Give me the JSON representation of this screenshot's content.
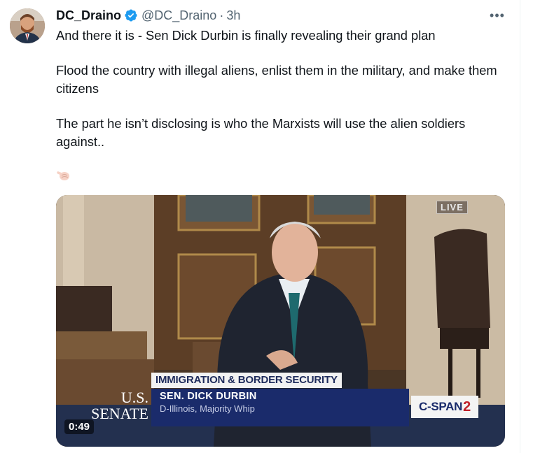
{
  "tweet": {
    "author_name": "DC_Draino",
    "handle": "@DC_Draino",
    "separator": "·",
    "time": "3h",
    "more_label": "•••",
    "paragraphs": [
      "And there it is - Sen Dick Durbin is finally revealing their grand plan",
      "Flood the country with illegal aliens, enlist them in the military, and make them citizens",
      "The part he isn’t disclosing is who the Marxists will use the alien soldiers against.."
    ],
    "emoji_icon": "pointing-hand-icon"
  },
  "video": {
    "live_badge": "LIVE",
    "chyron_topic": "IMMIGRATION & BORDER SECURITY",
    "chyron_name": "SEN. DICK DURBIN",
    "chyron_title": "D-Illinois, Majority Whip",
    "senate_line1": "U.S.",
    "senate_line2": "SENATE",
    "network_text": "C-SPAN",
    "network_number": "2",
    "duration": "0:49"
  },
  "colors": {
    "verified": "#1d9bf0",
    "chyron_blue": "#1a2b6b",
    "cspan_red": "#c0202a"
  }
}
